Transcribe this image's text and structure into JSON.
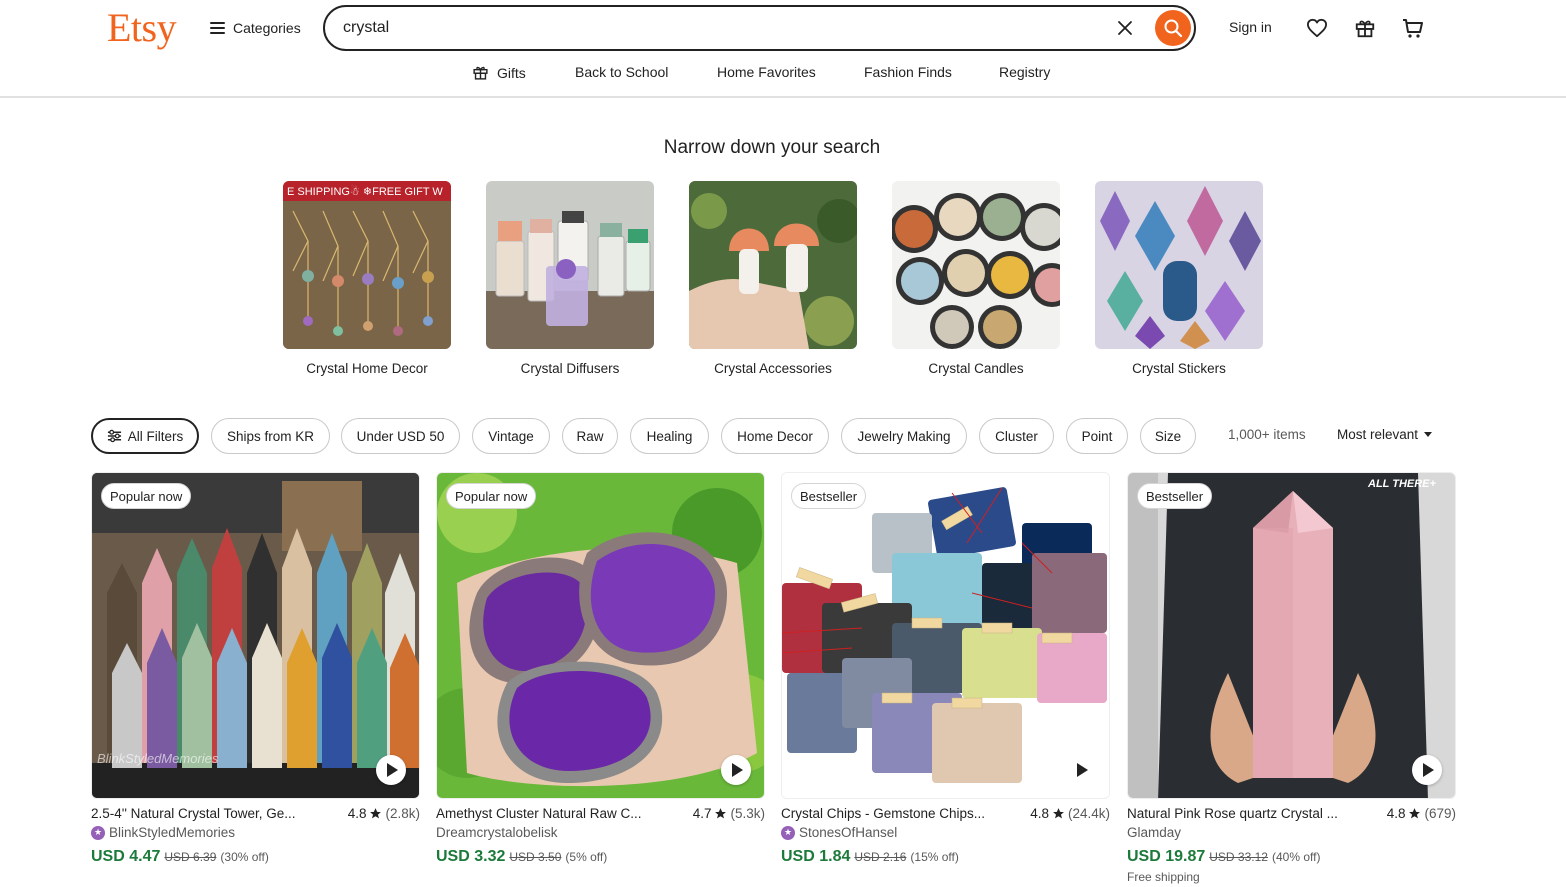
{
  "brand": {
    "logo_text": "Etsy",
    "accent_color": "#f1641e"
  },
  "header": {
    "categories_label": "Categories",
    "search_value": "crystal",
    "signin_label": "Sign in",
    "icons": [
      "search-icon",
      "clear-icon",
      "heart-icon",
      "gift-icon",
      "cart-icon"
    ]
  },
  "nav": {
    "gifts": "Gifts",
    "back_to_school": "Back to School",
    "home_favorites": "Home Favorites",
    "fashion_finds": "Fashion Finds",
    "registry": "Registry"
  },
  "narrow": {
    "title": "Narrow down your search",
    "items": [
      {
        "label": "Crystal Home Decor",
        "banner": "E SHIPPING☃ ❄FREE GIFT W"
      },
      {
        "label": "Crystal Diffusers"
      },
      {
        "label": "Crystal Accessories"
      },
      {
        "label": "Crystal Candles"
      },
      {
        "label": "Crystal Stickers"
      }
    ]
  },
  "filters": {
    "all_filters": "All Filters",
    "chips": [
      "Ships from KR",
      "Under USD 50",
      "Vintage",
      "Raw",
      "Healing",
      "Home Decor",
      "Jewelry Making",
      "Cluster",
      "Point",
      "Size"
    ],
    "items_count": "1,000+ items",
    "sort_label": "Most relevant"
  },
  "products": [
    {
      "badge": "Popular now",
      "title": "2.5-4'' Natural Crystal Tower, Ge...",
      "rating": "4.8",
      "reviews": "(2.8k)",
      "shop": "BlinkStyledMemories",
      "price": "USD 4.47",
      "original": "USD 6.39",
      "discount": "(30% off)",
      "watermark": "BlinkStyledMemories"
    },
    {
      "badge": "Popular now",
      "title": "Amethyst Cluster Natural Raw C...",
      "rating": "4.7",
      "reviews": "(5.3k)",
      "shop": "Dreamcrystalobelisk",
      "price": "USD 3.32",
      "original": "USD 3.50",
      "discount": "(5% off)"
    },
    {
      "badge": "Bestseller",
      "title": "Crystal Chips - Gemstone Chips...",
      "rating": "4.8",
      "reviews": "(24.4k)",
      "shop": "StonesOfHansel",
      "price": "USD 1.84",
      "original": "USD 2.16",
      "discount": "(15% off)"
    },
    {
      "badge": "Bestseller",
      "title": "Natural Pink Rose quartz Crystal ...",
      "rating": "4.8",
      "reviews": "(679)",
      "shop": "Glamday",
      "price": "USD 19.87",
      "original": "USD 33.12",
      "discount": "(40% off)",
      "shipping": "Free shipping",
      "image_text": "ALL THERE+"
    }
  ]
}
